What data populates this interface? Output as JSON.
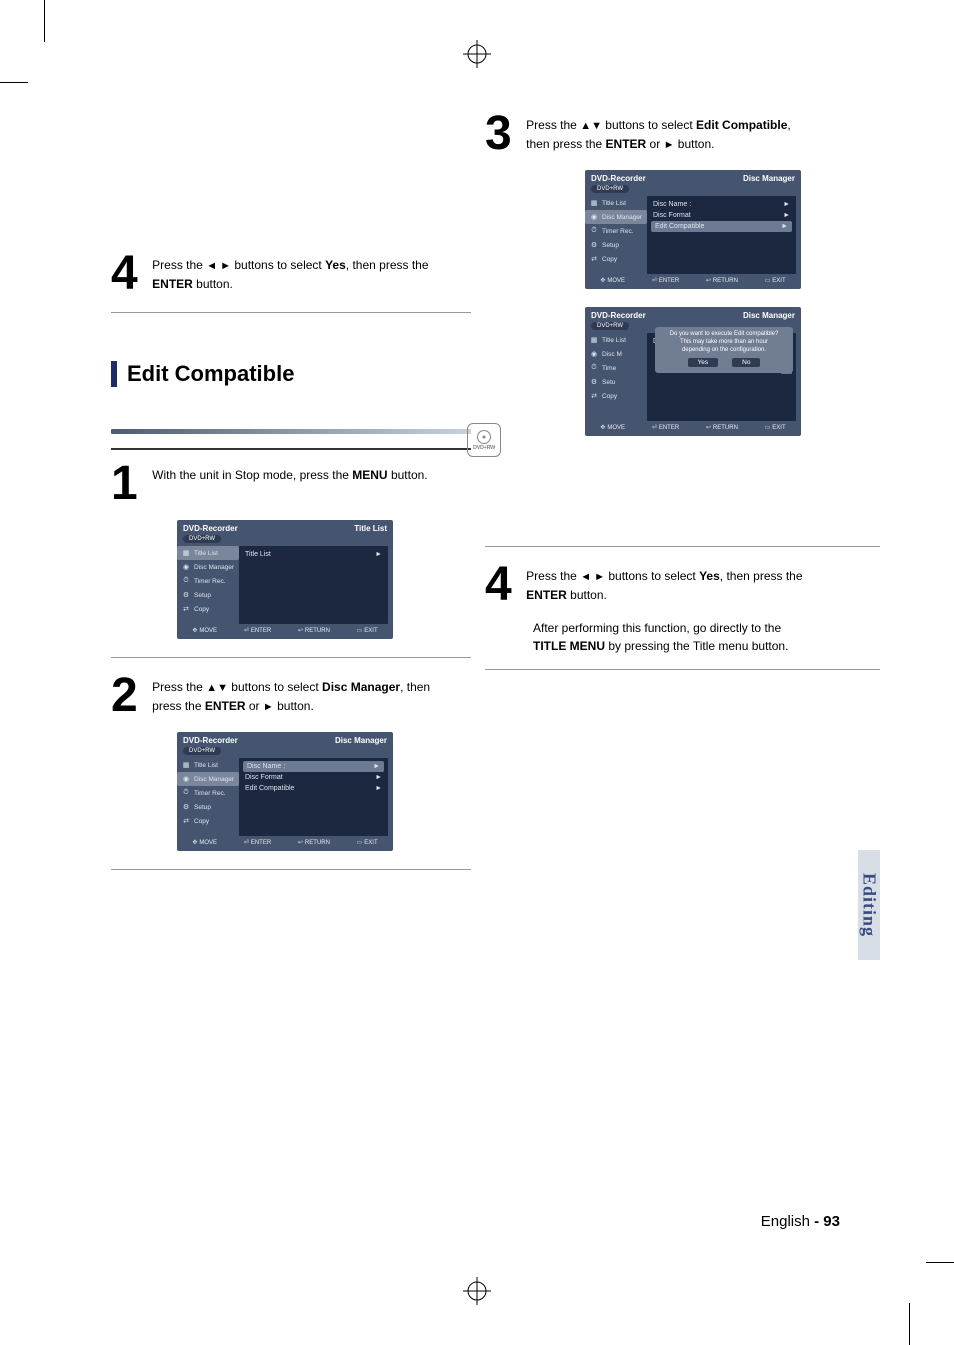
{
  "sidetab": "Editing",
  "page_number_prefix": "English ",
  "page_number": "- 93",
  "left": {
    "step4_top": {
      "num": "4",
      "line1_pre": "Press the ",
      "line1_tri": "◄ ►",
      "line1_mid": " buttons to select ",
      "line1_bold": "Yes",
      "line1_post": ", then press the",
      "line2_bold": "ENTER",
      "line2_post": " button."
    },
    "section_title": "Edit Compatible",
    "dvdrw_label": "DVD+RW",
    "step1": {
      "num": "1",
      "line1_pre": "With the unit in Stop mode, press the ",
      "line1_bold": "MENU",
      "line1_post": " button."
    },
    "panelA": {
      "hdr_left": "DVD-Recorder",
      "hdr_right": "Title List",
      "disc": "DVD+RW",
      "sidebar": [
        {
          "icon": "▦",
          "label": "Title List",
          "sel": true
        },
        {
          "icon": "◉",
          "label": "Disc Manager"
        },
        {
          "icon": "⏱",
          "label": "Timer Rec."
        },
        {
          "icon": "⚙",
          "label": "Setup"
        },
        {
          "icon": "⇄",
          "label": "Copy"
        }
      ],
      "main": [
        {
          "label": "Title List",
          "arrow": "►",
          "sel": false
        }
      ],
      "footer": {
        "move": "MOVE",
        "enter": "ENTER",
        "return": "RETURN",
        "exit": "EXIT"
      }
    },
    "step2": {
      "num": "2",
      "line1_pre": "Press the ",
      "line1_tri": "▲▼",
      "line1_mid": " buttons to select ",
      "line1_bold": "Disc Manager",
      "line1_post": ", then",
      "line2_pre": "press the ",
      "line2_bold1": "ENTER",
      "line2_mid": " or ",
      "line2_tri": "►",
      "line2_post": " button."
    },
    "panelB": {
      "hdr_left": "DVD-Recorder",
      "hdr_right": "Disc Manager",
      "disc": "DVD+RW",
      "sidebar": [
        {
          "icon": "▦",
          "label": "Title List"
        },
        {
          "icon": "◉",
          "label": "Disc Manager",
          "sel": true
        },
        {
          "icon": "⏱",
          "label": "Timer Rec."
        },
        {
          "icon": "⚙",
          "label": "Setup"
        },
        {
          "icon": "⇄",
          "label": "Copy"
        }
      ],
      "main": [
        {
          "label": "Disc Name",
          "colon": ":",
          "arrow": "►",
          "sel": true
        },
        {
          "label": "Disc Format",
          "arrow": "►"
        },
        {
          "label": "Edit Compatible",
          "arrow": "►"
        }
      ],
      "footer": {
        "move": "MOVE",
        "enter": "ENTER",
        "return": "RETURN",
        "exit": "EXIT"
      }
    }
  },
  "right": {
    "step3": {
      "num": "3",
      "line1_pre": "Press the ",
      "line1_tri": "▲▼",
      "line1_mid": " buttons to select ",
      "line1_bold": "Edit Compatible",
      "line1_post": ",",
      "line2_pre": "then press the ",
      "line2_bold1": "ENTER",
      "line2_mid": " or ",
      "line2_tri": "►",
      "line2_post": " button."
    },
    "panelA": {
      "hdr_left": "DVD-Recorder",
      "hdr_right": "Disc Manager",
      "disc": "DVD+RW",
      "sidebar": [
        {
          "icon": "▦",
          "label": "Title List"
        },
        {
          "icon": "◉",
          "label": "Disc Manager",
          "sel": true
        },
        {
          "icon": "⏱",
          "label": "Timer Rec."
        },
        {
          "icon": "⚙",
          "label": "Setup"
        },
        {
          "icon": "⇄",
          "label": "Copy"
        }
      ],
      "main": [
        {
          "label": "Disc Name",
          "colon": ":",
          "arrow": "►"
        },
        {
          "label": "Disc Format",
          "arrow": "►"
        },
        {
          "label": "Edit Compatible",
          "arrow": "►",
          "sel": true
        }
      ],
      "footer": {
        "move": "MOVE",
        "enter": "ENTER",
        "return": "RETURN",
        "exit": "EXIT"
      }
    },
    "panelB": {
      "hdr_left": "DVD-Recorder",
      "hdr_right": "Disc Manager",
      "disc": "DVD+RW",
      "sidebar": [
        {
          "icon": "▦",
          "label": "Title List"
        },
        {
          "icon": "◉",
          "label": "Disc M"
        },
        {
          "icon": "⏱",
          "label": "Time"
        },
        {
          "icon": "⚙",
          "label": "Setu"
        },
        {
          "icon": "⇄",
          "label": "Copy"
        }
      ],
      "main_top": {
        "label": "Disc Name",
        "colon": ":",
        "arrow": "►"
      },
      "dialog": {
        "l1": "Do you want to execute Edit compatible?",
        "l2": "This may take more than an hour",
        "l3": "depending on the configuration.",
        "yes": "Yes",
        "no": "No"
      },
      "arrows_right": [
        "►",
        "►"
      ],
      "footer": {
        "move": "MOVE",
        "enter": "ENTER",
        "return": "RETURN",
        "exit": "EXIT"
      }
    },
    "step4": {
      "num": "4",
      "line1_pre": "Press the ",
      "line1_tri": "◄ ►",
      "line1_mid": " buttons to select ",
      "line1_bold": "Yes",
      "line1_post": ", then press the",
      "line2_bold": "ENTER",
      "line2_post": " button.",
      "para_pre": "After performing this function, go directly to the ",
      "para_bold": "TITLE MENU",
      "para_post": " by pressing the Title menu button."
    }
  }
}
